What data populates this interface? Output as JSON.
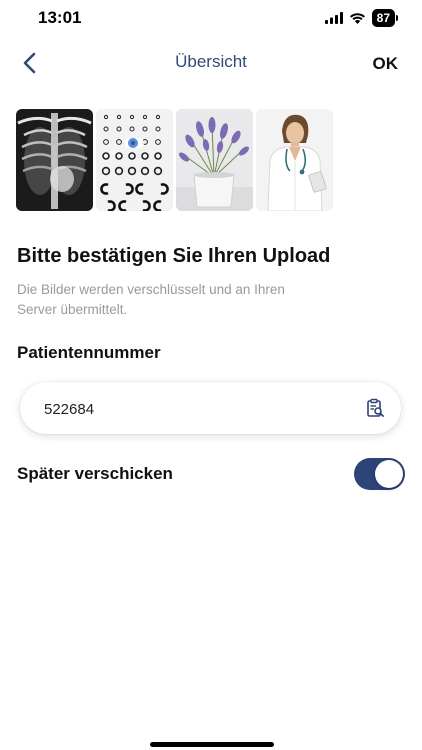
{
  "status_bar": {
    "time": "13:01",
    "battery": "87"
  },
  "nav": {
    "title": "Übersicht",
    "ok_label": "OK"
  },
  "thumbnails": [
    {
      "icon": "xray-image"
    },
    {
      "icon": "eye-chart-image"
    },
    {
      "icon": "lavender-plant-image"
    },
    {
      "icon": "doctor-photo-image"
    }
  ],
  "upload": {
    "title": "Bitte bestätigen Sie Ihren Upload",
    "description": "Die Bilder werden verschlüsselt und an Ihren Server übermittelt."
  },
  "patient": {
    "label": "Patientennummer",
    "value": "522684"
  },
  "later": {
    "label": "Später verschicken",
    "enabled": true
  },
  "colors": {
    "accent": "#2c4478",
    "title": "#2f4a7a",
    "muted": "#9a9a9a"
  }
}
